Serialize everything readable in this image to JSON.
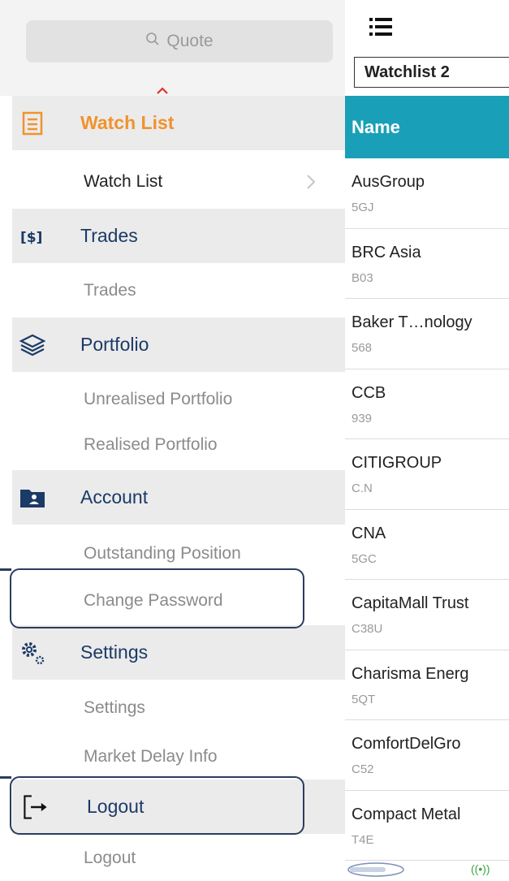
{
  "search": {
    "placeholder": "Quote"
  },
  "sidebar": {
    "sections": [
      {
        "label": "Watch List",
        "active": true,
        "icon": "watchlist-icon",
        "items": [
          {
            "label": "Watch List",
            "current": true
          }
        ]
      },
      {
        "label": "Trades",
        "icon": "trades-icon",
        "items": [
          {
            "label": "Trades"
          }
        ]
      },
      {
        "label": "Portfolio",
        "icon": "portfolio-icon",
        "items": [
          {
            "label": "Unrealised Portfolio"
          },
          {
            "label": "Realised Portfolio"
          }
        ]
      },
      {
        "label": "Account",
        "icon": "account-icon",
        "items": [
          {
            "label": "Outstanding Position"
          },
          {
            "label": "Change Password",
            "highlighted": true
          }
        ]
      },
      {
        "label": "Settings",
        "icon": "settings-icon",
        "items": [
          {
            "label": "Settings"
          },
          {
            "label": "Market Delay Info"
          }
        ]
      },
      {
        "label": "Logout",
        "icon": "logout-icon",
        "highlighted": true,
        "items": [
          {
            "label": "Logout"
          }
        ]
      }
    ]
  },
  "watchlist": {
    "selected": "Watchlist 2",
    "column_header": "Name",
    "rows": [
      {
        "name": "AusGroup",
        "code": "5GJ"
      },
      {
        "name": "BRC Asia",
        "code": "B03"
      },
      {
        "name": "Baker T…nology",
        "code": "568"
      },
      {
        "name": "CCB",
        "code": "939"
      },
      {
        "name": "CITIGROUP",
        "code": "C.N"
      },
      {
        "name": "CNA",
        "code": "5GC"
      },
      {
        "name": "CapitaMall Trust",
        "code": "C38U"
      },
      {
        "name": "Charisma Energ",
        "code": "5QT"
      },
      {
        "name": "ComfortDelGro",
        "code": "C52"
      },
      {
        "name": "Compact Metal",
        "code": "T4E"
      }
    ]
  },
  "colors": {
    "accent": "#f0932e",
    "nav_text": "#1b3a66",
    "header_teal": "#1a9fb8",
    "highlight_border": "#2a3d5e"
  }
}
